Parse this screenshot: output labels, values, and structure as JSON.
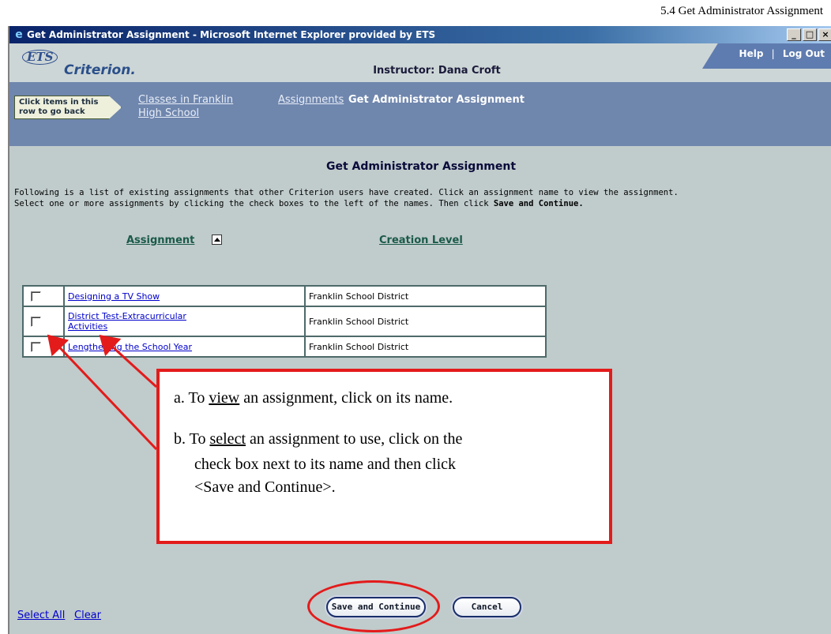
{
  "doc_header": "5.4 Get Administrator Assignment",
  "window": {
    "title": "Get Administrator Assignment - Microsoft Internet Explorer provided by ETS",
    "buttons": [
      "_",
      "□",
      "×"
    ]
  },
  "app_header": {
    "logo_ets": "ETS",
    "logo_product": "Criterion.",
    "instructor": "Instructor: Dana Croft",
    "help": "Help",
    "logout": "Log Out",
    "separator": "|"
  },
  "breadcrumb": {
    "hint_line1": "Click items in this",
    "hint_line2": "row to go back",
    "link1_line1": "Classes in Franklin",
    "link1_line2": "High School",
    "link2": "Assignments",
    "current": "Get Administrator Assignment"
  },
  "main": {
    "title": "Get Administrator Assignment",
    "intro_line1": "Following is a list of existing assignments that other Criterion users have created. Click an assignment name to view the assignment.",
    "intro_line2_pre": "Select one or more assignments by clicking the check boxes to the left of the names. Then click ",
    "intro_line2_bold": "Save and Continue.",
    "col_assignment": "Assignment",
    "col_creation": "Creation Level",
    "rows": [
      {
        "name": "Designing a TV Show",
        "name2": "",
        "level": "Franklin School District"
      },
      {
        "name": "District Test-Extracurricular",
        "name2": "Activities",
        "level": "Franklin School District"
      },
      {
        "name": "Lengthening the School Year",
        "name2": "",
        "level": "Franklin School District"
      }
    ]
  },
  "callout": {
    "a_prefix": "a. To ",
    "a_under": "view",
    "a_suffix": " an assignment, click on its name.",
    "b_prefix": "b. To ",
    "b_under": "select",
    "b_suffix": " an assignment to use, click on the",
    "b_line2": "check box next to its name and then click",
    "b_line3": "<Save and Continue>."
  },
  "footer": {
    "select_all": "Select All",
    "clear": "Clear",
    "save_continue": "Save and Continue",
    "cancel": "Cancel"
  }
}
